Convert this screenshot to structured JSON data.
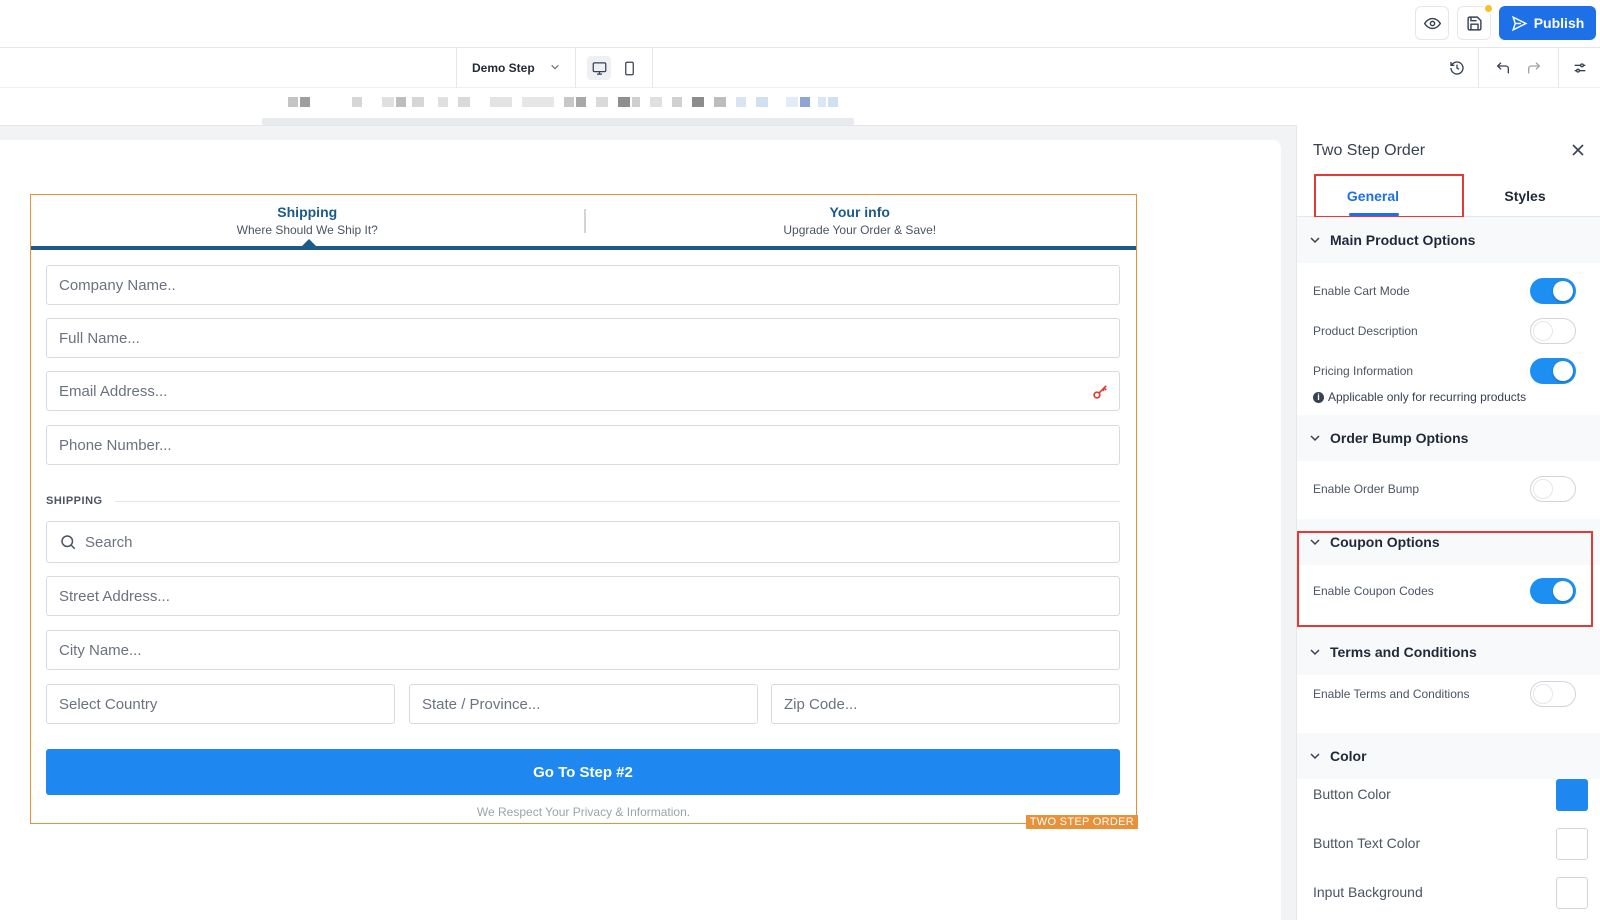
{
  "topbar": {
    "preview_icon": "eye-icon",
    "save_icon": "save-icon",
    "publish_label": "Publish",
    "publish_icon": "send-icon"
  },
  "toolbar": {
    "step_name": "Demo Step",
    "devices": [
      "desktop",
      "mobile"
    ],
    "active_device": "desktop"
  },
  "form": {
    "steps": [
      {
        "title": "Shipping",
        "subtitle": "Where Should We Ship It?"
      },
      {
        "title": "Your info",
        "subtitle": "Upgrade Your Order & Save!"
      }
    ],
    "fields": {
      "company": "Company Name..",
      "full_name": "Full Name...",
      "email": "Email Address...",
      "phone": "Phone Number...",
      "search": "Search",
      "street": "Street Address...",
      "city": "City Name...",
      "country": "Select Country",
      "state": "State / Province...",
      "zip": "Zip Code..."
    },
    "shipping_label": "SHIPPING",
    "button_label": "Go To Step #2",
    "privacy_text": "We Respect Your Privacy & Information.",
    "element_tag": "TWO STEP ORDER"
  },
  "panel": {
    "title": "Two Step Order",
    "tabs": [
      "General",
      "Styles"
    ],
    "active_tab": "General",
    "sections": {
      "main_product": {
        "title": "Main Product Options",
        "enable_cart_mode": {
          "label": "Enable Cart Mode",
          "on": true
        },
        "product_description": {
          "label": "Product Description",
          "on": false
        },
        "pricing_information": {
          "label": "Pricing Information",
          "on": true
        },
        "note": "Applicable only for recurring products"
      },
      "order_bump": {
        "title": "Order Bump Options",
        "enable_order_bump": {
          "label": "Enable Order Bump",
          "on": false
        }
      },
      "coupon": {
        "title": "Coupon Options",
        "enable_coupon_codes": {
          "label": "Enable Coupon Codes",
          "on": true
        }
      },
      "terms": {
        "title": "Terms and Conditions",
        "enable_terms": {
          "label": "Enable Terms and Conditions",
          "on": false
        }
      },
      "color": {
        "title": "Color",
        "button_color": {
          "label": "Button Color",
          "value": "#1e88f0"
        },
        "button_text_color": {
          "label": "Button Text Color",
          "value": "#ffffff"
        },
        "input_background": {
          "label": "Input Background",
          "value": "#ffffff"
        }
      }
    }
  },
  "colors": {
    "accent": "#1d70e8",
    "form_accent": "#1c5a8c",
    "element_outline": "#e8913b",
    "highlight": "#e53935",
    "notification": "#fbbf24"
  }
}
